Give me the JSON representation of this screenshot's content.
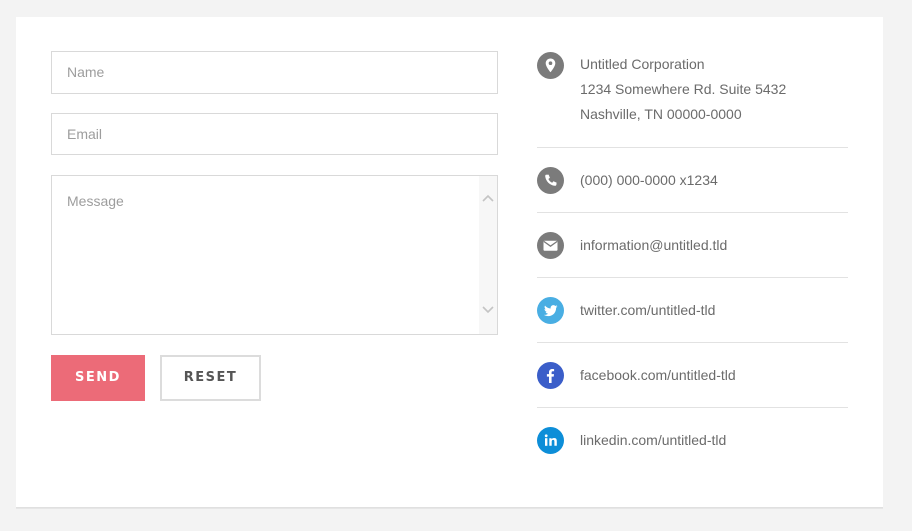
{
  "form": {
    "name_placeholder": "Name",
    "email_placeholder": "Email",
    "message_placeholder": "Message",
    "send_label": "SEND",
    "reset_label": "RESET"
  },
  "contact": {
    "address": {
      "icon": "map-pin-icon",
      "line1": "Untitled Corporation",
      "line2": "1234 Somewhere Rd. Suite 5432",
      "line3": "Nashville, TN 00000-0000"
    },
    "phone": {
      "icon": "phone-icon",
      "text": "(000) 000-0000 x1234"
    },
    "email": {
      "icon": "envelope-icon",
      "text": "information@untitled.tld"
    },
    "twitter": {
      "icon": "twitter-icon",
      "text": "twitter.com/untitled-tld"
    },
    "facebook": {
      "icon": "facebook-icon",
      "text": "facebook.com/untitled-tld"
    },
    "linkedin": {
      "icon": "linkedin-icon",
      "text": "linkedin.com/untitled-tld"
    }
  },
  "colors": {
    "page_bg": "#f3f3f3",
    "accent": "#ec6b78",
    "gray_icon": "#7b7b7b",
    "twitter": "#49aee3",
    "facebook": "#3b5ec9",
    "linkedin": "#0d8ed8"
  }
}
